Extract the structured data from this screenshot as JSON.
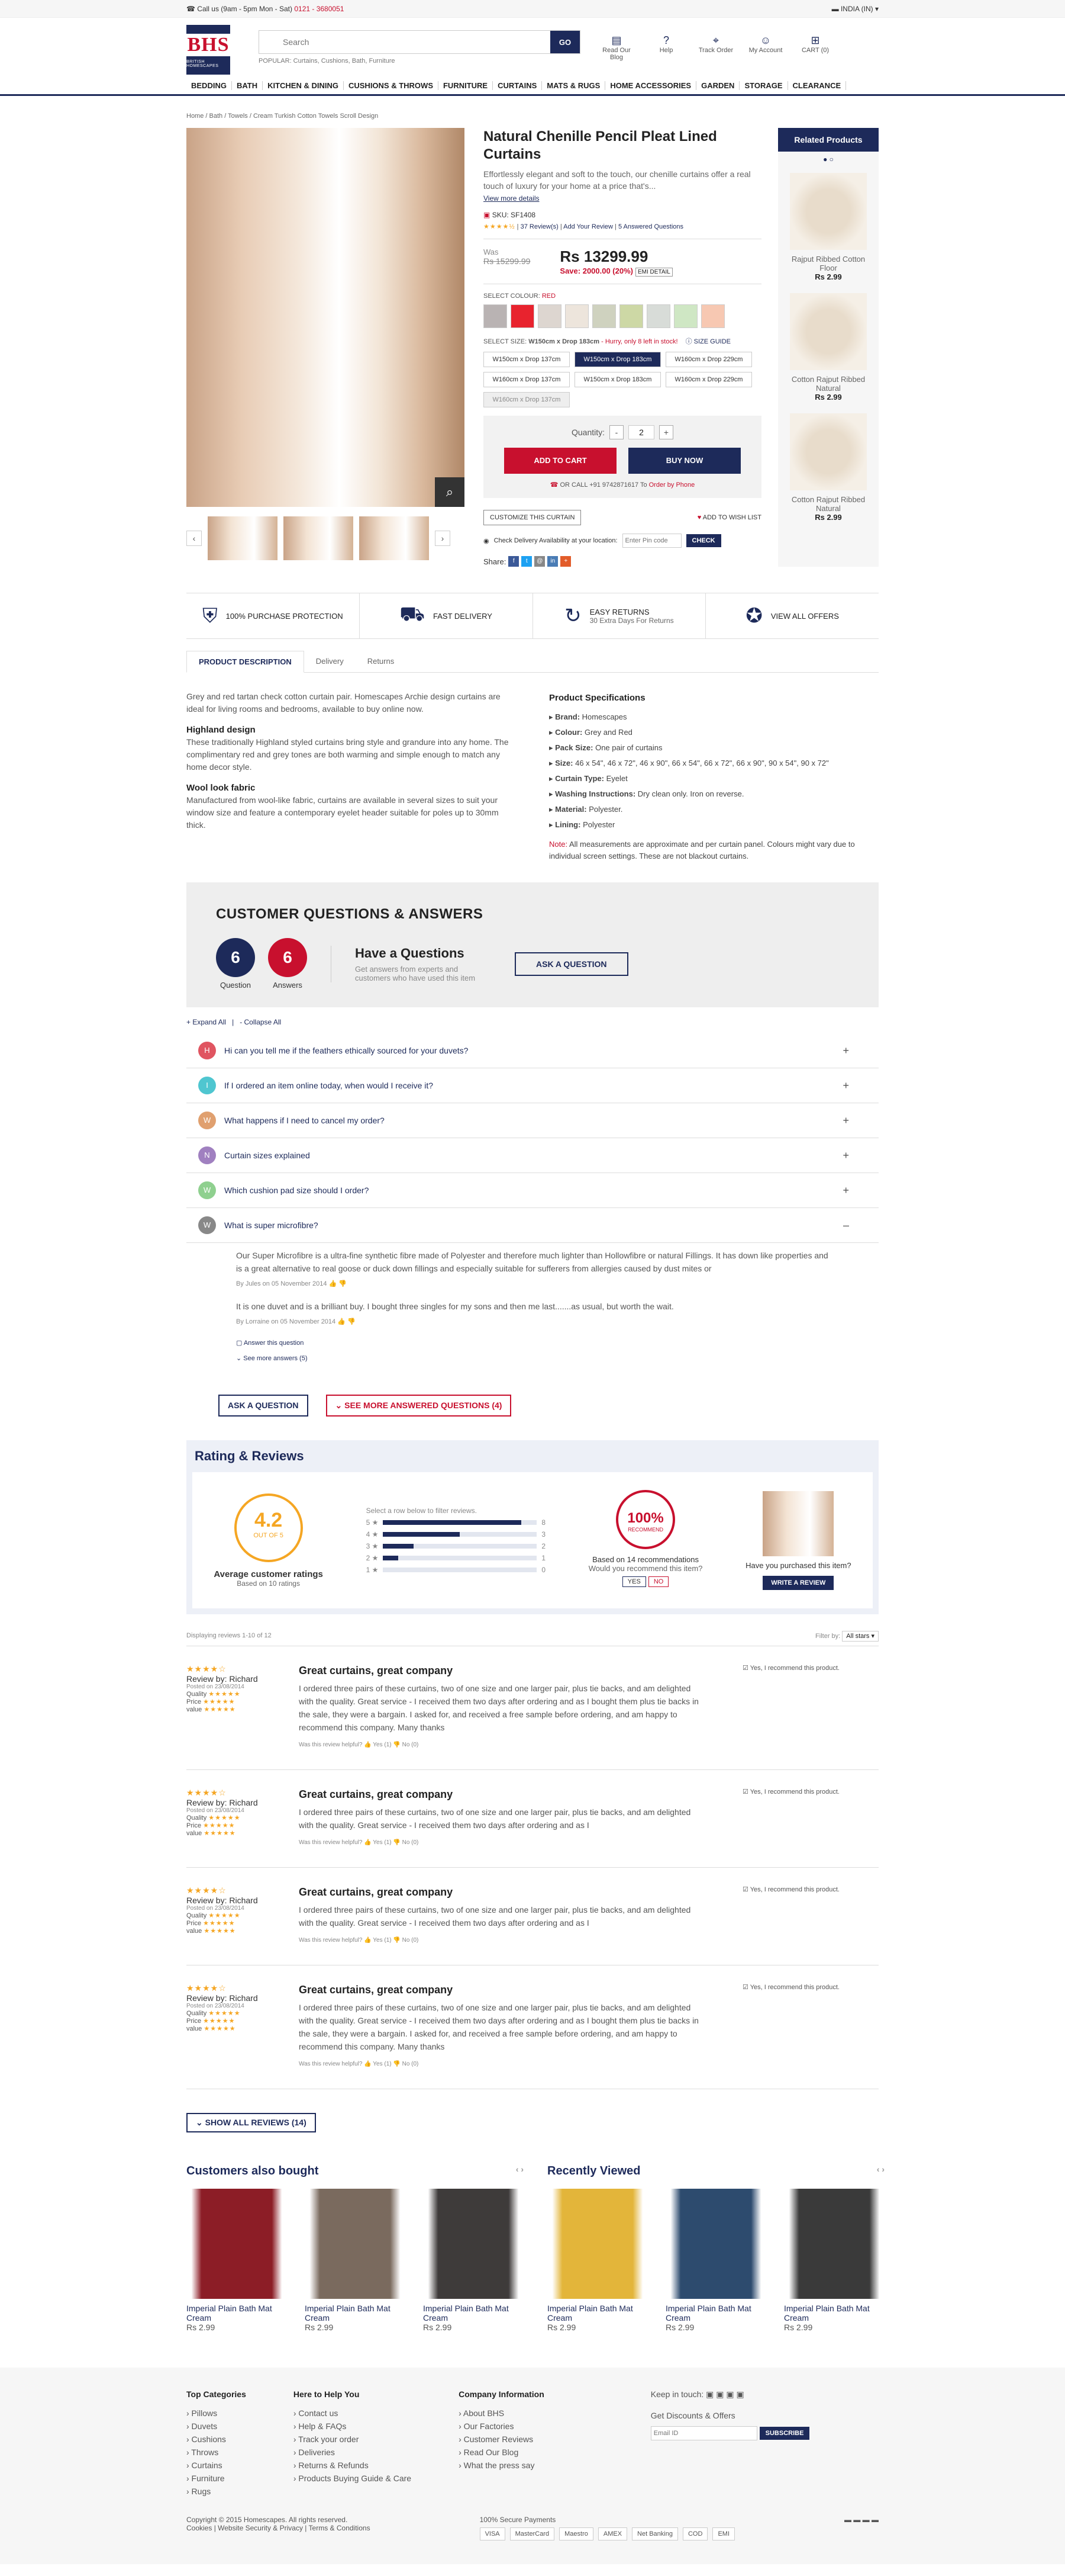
{
  "topbar": {
    "call": "Call us (9am - 5pm Mon - Sat)",
    "phone": "0121 - 3680051",
    "country": "INDIA (IN)"
  },
  "logo": {
    "text": "BHS",
    "tagline": "BRITISH HOMESCAPES"
  },
  "search": {
    "placeholder": "Search",
    "button": "GO",
    "popular": "POPULAR: Curtains, Cushions, Bath, Furniture"
  },
  "header_icons": [
    {
      "label": "Read Our Blog",
      "icon": "book-icon"
    },
    {
      "label": "Help",
      "icon": "help-icon"
    },
    {
      "label": "Track Order",
      "icon": "pin-icon"
    },
    {
      "label": "My Account",
      "icon": "user-icon"
    },
    {
      "label": "CART (0)",
      "icon": "cart-icon"
    }
  ],
  "nav": [
    "BEDDING",
    "BATH",
    "KITCHEN & DINING",
    "CUSHIONS & THROWS",
    "FURNITURE",
    "CURTAINS",
    "MATS & RUGS",
    "HOME ACCESSORIES",
    "GARDEN",
    "STORAGE",
    "CLEARANCE"
  ],
  "breadcrumb": [
    "Home",
    "Bath",
    "Towels",
    "Cream Turkish Cotton Towels Scroll Design"
  ],
  "product": {
    "title": "Natural Chenille Pencil Pleat Lined Curtains",
    "desc": "Effortlessly elegant and soft to the touch, our chenille curtains offer a real touch of luxury for your home at a price that's...",
    "view_more": "View more details",
    "sku": "SKU: SF1408",
    "reviews": "37 Review(s)",
    "add_review": "Add Your Review",
    "answered": "5 Answered Questions",
    "was_label": "Was",
    "was": "Rs 15299.99",
    "now": "Rs 13299.99",
    "save": "Save: 2000.00 (20%)",
    "emi": "EMI DETAIL",
    "colour_label": "SELECT COLOUR:",
    "colour_value": "RED",
    "swatches": [
      "#b9b3b3",
      "#e8232e",
      "#ddd6d0",
      "#ede5dc",
      "#cfd2bf",
      "#cdd8a5",
      "#d8dcd8",
      "#cfe7c4",
      "#f7c8b2"
    ],
    "size_label": "SELECT SIZE:",
    "size_value": "W150cm x Drop 183cm",
    "size_note": "- Hurry, only 8 left in stock!",
    "size_guide": "SIZE GUIDE",
    "sizes": [
      "W150cm x Drop 137cm",
      "W150cm x Drop 183cm",
      "W160cm x Drop 229cm",
      "W160cm x Drop 137cm",
      "W150cm x Drop 183cm",
      "W160cm x Drop 229cm",
      "W160cm x Drop 137cm"
    ],
    "qty_label": "Quantity:",
    "qty": "2",
    "add_to_cart": "ADD TO CART",
    "buy_now": "BUY NOW",
    "call": "OR CALL +91 9742871617 To",
    "call_link": "Order by Phone",
    "customize": "CUSTOMIZE THIS CURTAIN",
    "wishlist": "ADD TO WISH LIST",
    "delivery": "Check Delivery Availability at your location:",
    "pin_placeholder": "Enter Pin code",
    "check": "CHECK",
    "share": "Share:"
  },
  "related": {
    "title": "Related Products",
    "items": [
      {
        "name": "Rajput Ribbed Cotton Floor",
        "price": "Rs 2.99"
      },
      {
        "name": "Cotton Rajput Ribbed Natural",
        "price": "Rs 2.99"
      },
      {
        "name": "Cotton Rajput Ribbed Natural",
        "price": "Rs 2.99"
      }
    ]
  },
  "features": [
    {
      "t": "100% PURCHASE PROTECTION",
      "s": "",
      "icon": "shield-icon"
    },
    {
      "t": "FAST DELIVERY",
      "s": "",
      "icon": "truck-icon"
    },
    {
      "t": "EASY RETURNS",
      "s": "30 Extra Days For Returns",
      "icon": "return-icon"
    },
    {
      "t": "VIEW ALL OFFERS",
      "s": "",
      "icon": "offer-icon"
    }
  ],
  "tabs": [
    "PRODUCT DESCRIPTION",
    "Delivery",
    "Returns"
  ],
  "description": {
    "intro": "Grey and red tartan check cotton curtain pair. Homescapes Archie design curtains are ideal for living rooms and bedrooms, available to buy online now.",
    "h1": "Highland design",
    "p1": "These traditionally Highland styled curtains bring style and grandure into any home. The complimentary red and grey tones are both warming and simple enough to match any home decor style.",
    "h2": "Wool look fabric",
    "p2": "Manufactured from wool-like fabric, curtains are available in several sizes to suit your window size and feature a contemporary eyelet header suitable for poles up to 30mm thick."
  },
  "specs": {
    "title": "Product Specifications",
    "items": [
      "Brand: Homescapes",
      "Colour: Grey and Red",
      "Pack Size: One pair of curtains",
      "Size: 46 x 54\", 46 x 72\", 46 x 90\", 66 x 54\", 66 x 72\", 66 x 90\", 90 x 54\", 90 x 72\"",
      "Curtain Type: Eyelet",
      "Washing Instructions: Dry clean only. Iron on reverse.",
      "Material: Polyester.",
      "Lining: Polyester"
    ],
    "note_label": "Note:",
    "note": "All measurements are approximate and per curtain panel. Colours might vary due to individual screen settings. These are not blackout curtains."
  },
  "qa": {
    "title": "CUSTOMER QUESTIONS & ANSWERS",
    "questions_n": "6",
    "questions_l": "Question",
    "answers_n": "6",
    "answers_l": "Answers",
    "have_title": "Have a Questions",
    "have_sub": "Get answers from experts and customers who have used this item",
    "ask": "ASK A QUESTION",
    "expand": "+ Expand All",
    "collapse": "- Collapse All",
    "items": [
      {
        "a": "H",
        "c": "#e05561",
        "q": "Hi can you tell me if the feathers ethically sourced for your duvets?",
        "s": "+"
      },
      {
        "a": "I",
        "c": "#4fc6d0",
        "q": "If I ordered an item online today, when would I receive it?",
        "s": "+"
      },
      {
        "a": "W",
        "c": "#e0a06f",
        "q": "What happens if I need to cancel my order?",
        "s": "+"
      },
      {
        "a": "N",
        "c": "#a080c0",
        "q": "Curtain sizes explained",
        "s": "+"
      },
      {
        "a": "W",
        "c": "#8fd08f",
        "q": "Which cushion pad size should I order?",
        "s": "+"
      },
      {
        "a": "W",
        "c": "#888888",
        "q": "What is super microfibre?",
        "s": "–"
      }
    ],
    "answer1": "Our Super Microfibre is a ultra-fine synthetic fibre made of Polyester and therefore much lighter than Hollowfibre or natural Fillings. It has down like properties and is a great alternative to real goose or duck down fillings and especially suitable for sufferers from allergies caused by dust mites or",
    "answer1_by": "By Jules on 05 November 2014",
    "answer2": "It is one duvet and is a brilliant buy. I bought three singles for my sons and then me last.......as usual, but worth the wait.",
    "answer2_by": "By Lorraine on 05 November 2014",
    "answer_q": "Answer this question",
    "see_more": "See more answers (5)",
    "ask_btn": "ASK A QUESTION",
    "see_more_btn": "SEE MORE ANSWERED QUESTIONS (4)"
  },
  "ratings": {
    "title": "Rating & Reviews",
    "avg": "4.2",
    "out_of": "OUT OF 5",
    "avg_label": "Average customer ratings",
    "based": "Based on 10 ratings",
    "filter_hint": "Select a row below to filter reviews.",
    "bars": [
      {
        "s": "5",
        "v": 8,
        "f": 0.9
      },
      {
        "s": "4",
        "v": 3,
        "f": 0.5
      },
      {
        "s": "3",
        "v": 2,
        "f": 0.2
      },
      {
        "s": "2",
        "v": 1,
        "f": 0.1
      },
      {
        "s": "1",
        "v": 0,
        "f": 0
      }
    ],
    "rec": "100%",
    "rec_label": "RECOMMEND",
    "rec_based": "Based on 14 recommendations",
    "rec_q": "Would you recommend this item?",
    "yes": "YES",
    "no": "NO",
    "purchased": "Have you purchased this item?",
    "write": "WRITE A REVIEW",
    "displaying": "Displaying reviews 1-10 of 12",
    "filter_by": "Filter by:",
    "filter_value": "All stars"
  },
  "reviews": [
    {
      "by": "Review by: Richard",
      "date": "Posted on 23/08/2014",
      "title": "Great curtains, great company",
      "body": "I ordered three pairs of these curtains, two of one size and one larger pair, plus tie backs, and am delighted with the quality. Great service - I received them two days after ordering and as I bought them plus tie backs in the sale, they were a bargain. I asked for, and received a free sample before ordering, and am happy to recommend this company. Many thanks",
      "helpful": "Was this review helpful?",
      "yes": "Yes (1)",
      "no": "No (0)",
      "rec": "Yes, I recommend this product."
    },
    {
      "by": "Review by: Richard",
      "date": "Posted on 23/08/2014",
      "title": "Great curtains, great company",
      "body": "I ordered three pairs of these curtains, two of one size and one larger pair, plus tie backs, and am delighted with the quality. Great service - I received them two days after ordering and as I",
      "helpful": "Was this review helpful?",
      "yes": "Yes (1)",
      "no": "No (0)",
      "rec": "Yes, I recommend this product."
    },
    {
      "by": "Review by: Richard",
      "date": "Posted on 23/08/2014",
      "title": "Great curtains, great company",
      "body": "I ordered three pairs of these curtains, two of one size and one larger pair, plus tie backs, and am delighted with the quality. Great service - I received them two days after ordering and as I",
      "helpful": "Was this review helpful?",
      "yes": "Yes (1)",
      "no": "No (0)",
      "rec": "Yes, I recommend this product."
    },
    {
      "by": "Review by: Richard",
      "date": "Posted on 23/08/2014",
      "title": "Great curtains, great company",
      "body": "I ordered three pairs of these curtains, two of one size and one larger pair, plus tie backs, and am delighted with the quality. Great service - I received them two days after ordering and as I bought them plus tie backs in the sale, they were a bargain. I asked for, and received a free sample before ordering, and am happy to recommend this company. Many thanks",
      "helpful": "Was this review helpful?",
      "yes": "Yes (1)",
      "no": "No (0)",
      "rec": "Yes, I recommend this product."
    }
  ],
  "show_all": "SHOW ALL REVIEWS (14)",
  "also_bought": {
    "title": "Customers also bought",
    "items": [
      {
        "n": "Imperial Plain Bath Mat Cream",
        "p": "Rs 2.99",
        "c": "#8c1d26"
      },
      {
        "n": "Imperial Plain Bath Mat Cream",
        "p": "Rs 2.99",
        "c": "#7a6a5e"
      },
      {
        "n": "Imperial Plain Bath Mat Cream",
        "p": "Rs 2.99",
        "c": "#3e3b3a"
      }
    ]
  },
  "recently": {
    "title": "Recently Viewed",
    "items": [
      {
        "n": "Imperial Plain Bath Mat Cream",
        "p": "Rs 2.99",
        "c": "#e3b53a"
      },
      {
        "n": "Imperial Plain Bath Mat Cream",
        "p": "Rs 2.99",
        "c": "#2d4b6e"
      },
      {
        "n": "Imperial Plain Bath Mat Cream",
        "p": "Rs 2.99",
        "c": "#3a3a3a"
      }
    ]
  },
  "footer": {
    "cols": [
      {
        "h": "Top Categories",
        "items": [
          "Pillows",
          "Duvets",
          "Cushions",
          "Throws",
          "Curtains",
          "Furniture",
          "Rugs"
        ]
      },
      {
        "h": "Here to Help You",
        "items": [
          "Contact us",
          "Help & FAQs",
          "Track your order",
          "Deliveries",
          "Returns & Refunds",
          "Products Buying Guide & Care"
        ]
      },
      {
        "h": "Company Information",
        "items": [
          "About BHS",
          "Our Factories",
          "Customer Reviews",
          "Read Our Blog",
          "What the press say"
        ]
      }
    ],
    "keep": "Keep in touch:",
    "discounts": "Get Discounts & Offers",
    "email_placeholder": "Email ID",
    "subscribe": "SUBSCRIBE",
    "copyright": "Copyright © 2015 Homescapes. All rights reserved.",
    "links": "Cookies | Website Security & Privacy | Terms & Conditions",
    "secure": "100% Secure Payments",
    "payments": [
      "VISA",
      "MasterCard",
      "Maestro",
      "AMEX",
      "Net Banking",
      "COD",
      "EMI"
    ]
  }
}
